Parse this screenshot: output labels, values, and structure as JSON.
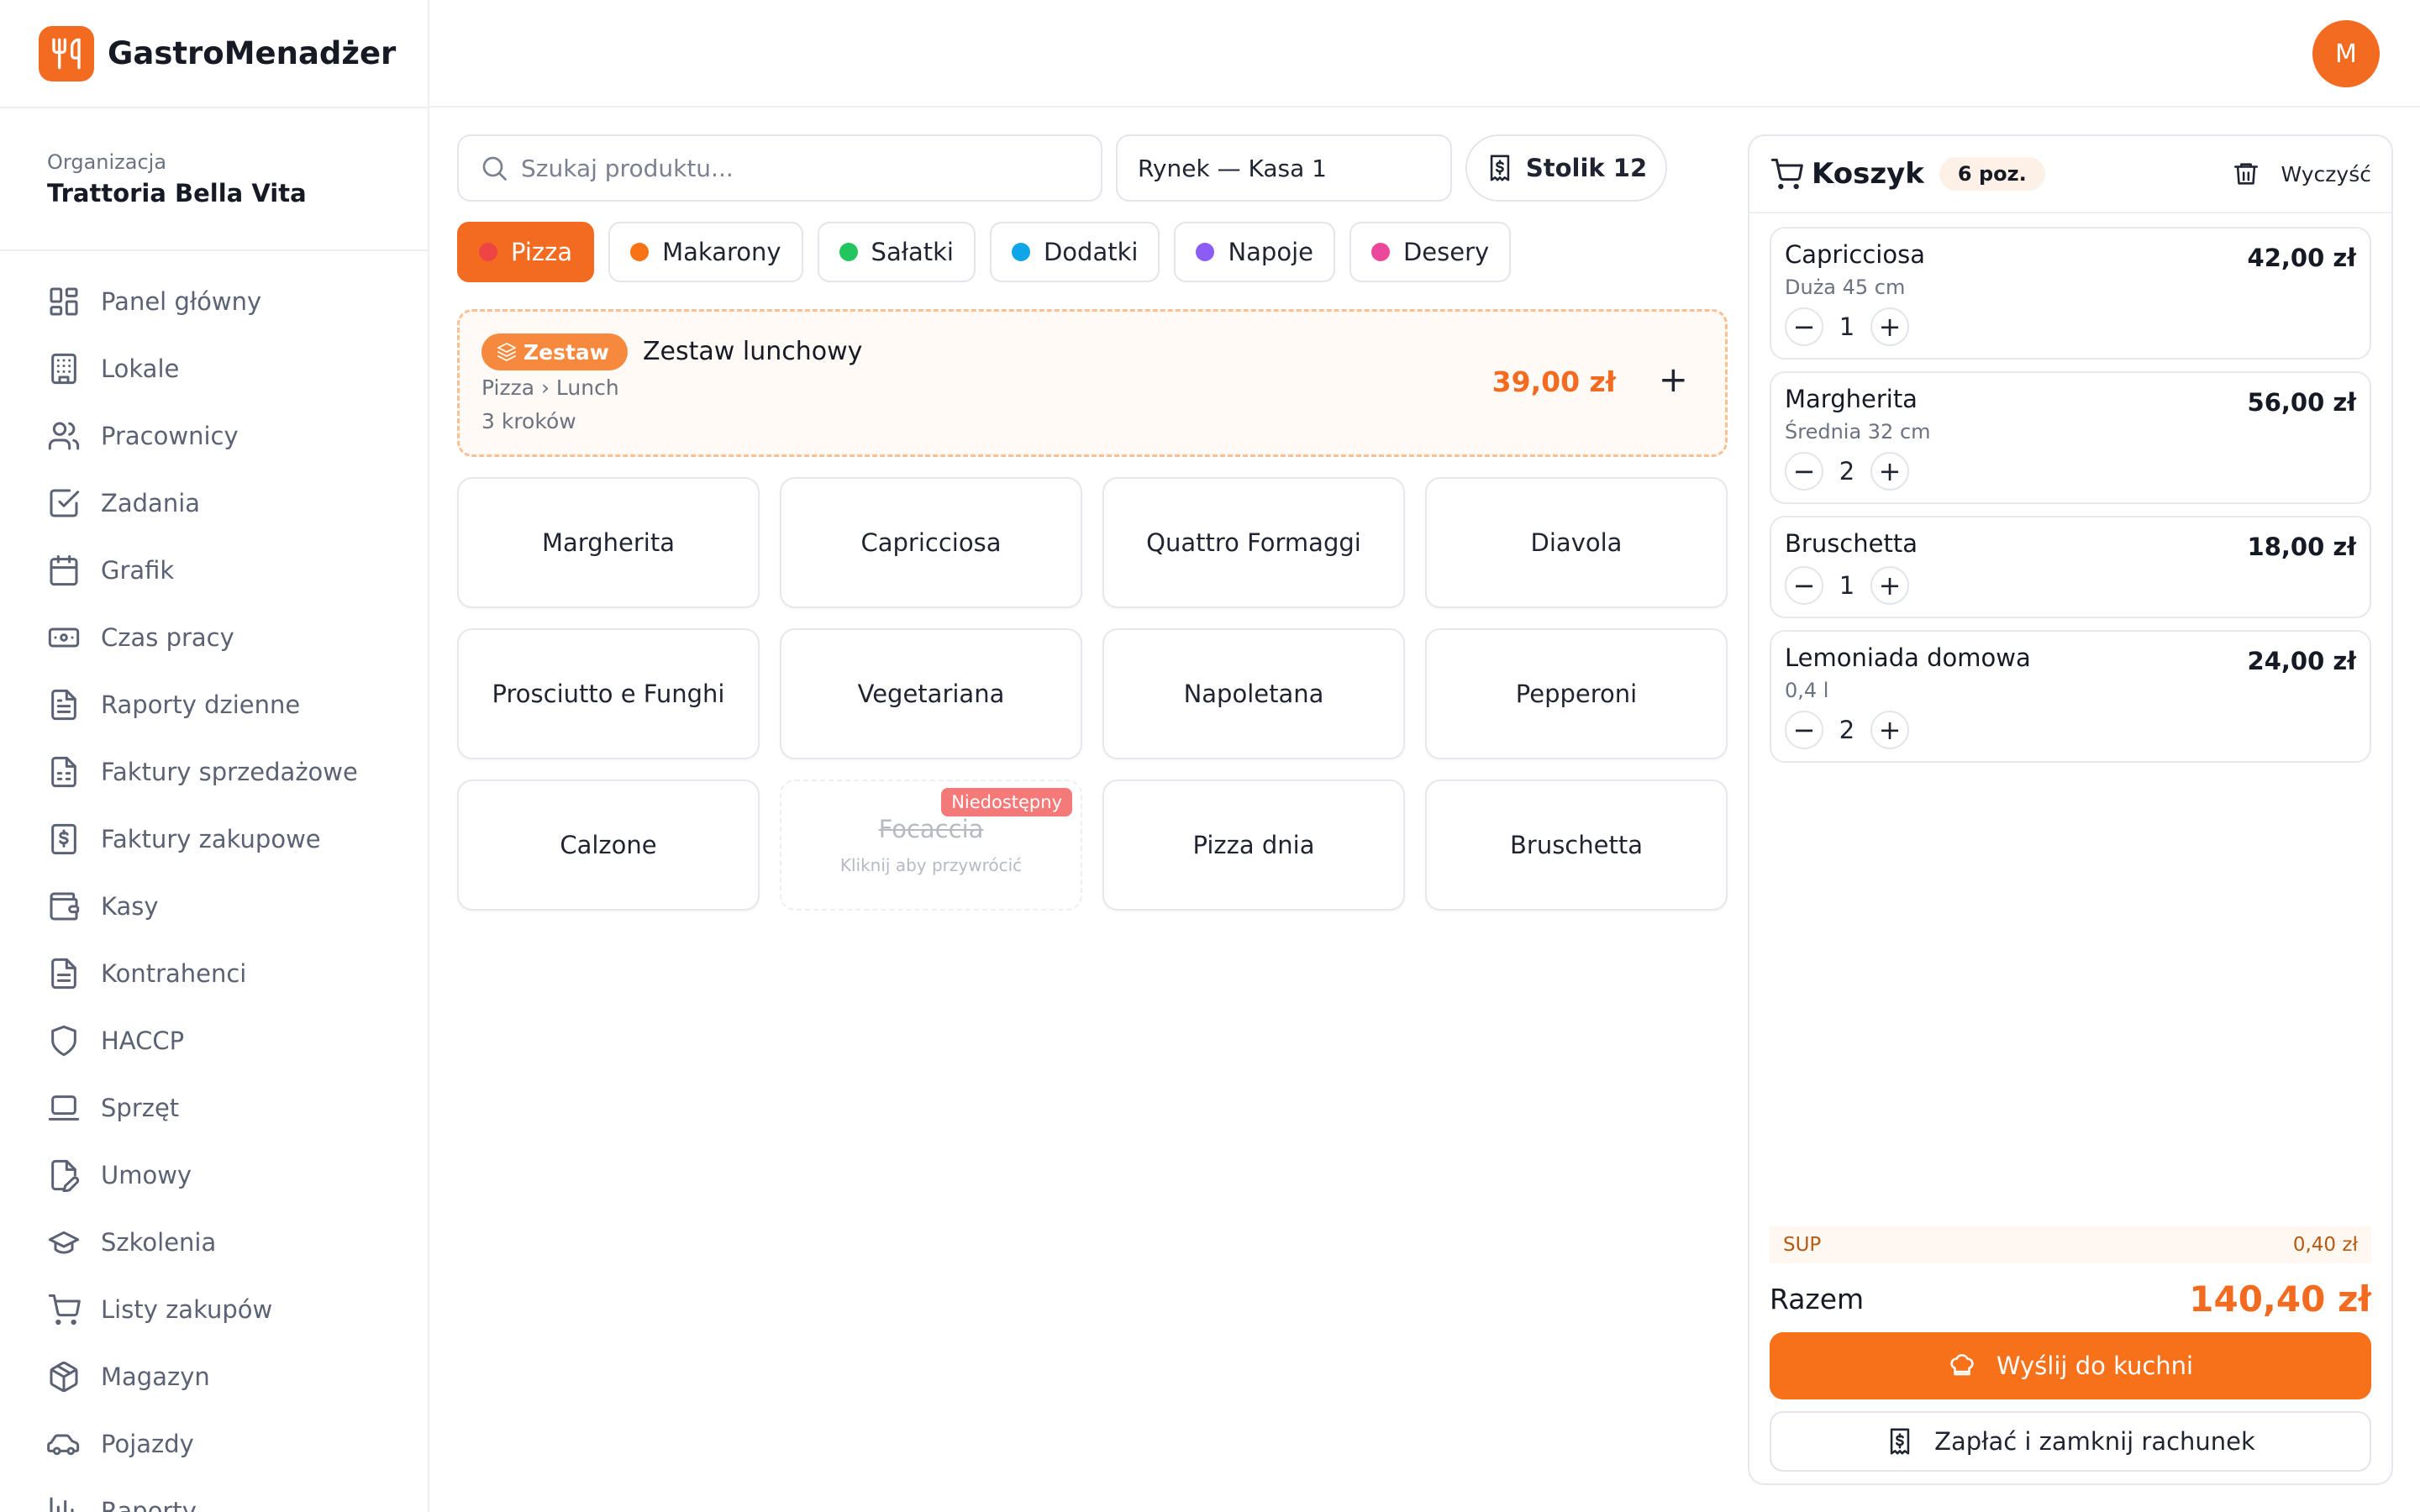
{
  "app": {
    "name": "GastroMenadżer",
    "logo_icon": "utensils-icon",
    "accent": "#f26b21"
  },
  "user": {
    "avatar_initial": "M"
  },
  "organization": {
    "label": "Organizacja",
    "name": "Trattoria Bella Vita"
  },
  "sidebar": {
    "items": [
      {
        "label": "Panel główny",
        "icon": "dashboard-icon"
      },
      {
        "label": "Lokale",
        "icon": "building-icon"
      },
      {
        "label": "Pracownicy",
        "icon": "users-icon"
      },
      {
        "label": "Zadania",
        "icon": "checkbox-icon"
      },
      {
        "label": "Grafik",
        "icon": "calendar-icon"
      },
      {
        "label": "Czas pracy",
        "icon": "banknote-icon"
      },
      {
        "label": "Raporty dzienne",
        "icon": "file-text-icon"
      },
      {
        "label": "Faktury sprzedażowe",
        "icon": "receipt-icon"
      },
      {
        "label": "Faktury zakupowe",
        "icon": "invoice-dollar-icon"
      },
      {
        "label": "Kasy",
        "icon": "wallet-icon"
      },
      {
        "label": "Kontrahenci",
        "icon": "file-icon"
      },
      {
        "label": "HACCP",
        "icon": "shield-icon"
      },
      {
        "label": "Sprzęt",
        "icon": "laptop-icon"
      },
      {
        "label": "Umowy",
        "icon": "file-pen-icon"
      },
      {
        "label": "Szkolenia",
        "icon": "graduation-cap-icon"
      },
      {
        "label": "Listy zakupów",
        "icon": "shopping-cart-icon"
      },
      {
        "label": "Magazyn",
        "icon": "package-icon"
      },
      {
        "label": "Pojazdy",
        "icon": "car-icon"
      },
      {
        "label": "Raporty",
        "icon": "chart-icon"
      }
    ]
  },
  "pos": {
    "search_placeholder": "Szukaj produktu...",
    "register": "Rynek — Kasa 1",
    "table": "Stolik 12",
    "categories": [
      {
        "label": "Pizza",
        "color": "#ef4444",
        "active": true
      },
      {
        "label": "Makarony",
        "color": "#f97316",
        "active": false
      },
      {
        "label": "Sałatki",
        "color": "#22c55e",
        "active": false
      },
      {
        "label": "Dodatki",
        "color": "#0ea5e9",
        "active": false
      },
      {
        "label": "Napoje",
        "color": "#8b5cf6",
        "active": false
      },
      {
        "label": "Desery",
        "color": "#ec4899",
        "active": false
      }
    ],
    "combo": {
      "badge": "Zestaw",
      "name": "Zestaw lunchowy",
      "path": "Pizza › Lunch",
      "steps": "3 kroków",
      "price": "39,00 zł",
      "add": "+"
    },
    "products": [
      {
        "name": "Margherita"
      },
      {
        "name": "Capricciosa"
      },
      {
        "name": "Quattro Formaggi"
      },
      {
        "name": "Diavola"
      },
      {
        "name": "Prosciutto e Funghi"
      },
      {
        "name": "Vegetariana"
      },
      {
        "name": "Napoletana"
      },
      {
        "name": "Pepperoni"
      },
      {
        "name": "Calzone"
      },
      {
        "name": "Focaccia",
        "unavailable": true,
        "badge": "Niedostępny",
        "hint": "Kliknij aby przywrócić"
      },
      {
        "name": "Pizza dnia"
      },
      {
        "name": "Bruschetta"
      }
    ]
  },
  "cart": {
    "title": "Koszyk",
    "count": "6 poz.",
    "clear": "Wyczyść",
    "items": [
      {
        "name": "Capricciosa",
        "variant": "Duża 45 cm",
        "price": "42,00 zł",
        "qty": "1"
      },
      {
        "name": "Margherita",
        "variant": "Średnia 32 cm",
        "price": "56,00 zł",
        "qty": "2"
      },
      {
        "name": "Bruschetta",
        "variant": "",
        "price": "18,00 zł",
        "qty": "1"
      },
      {
        "name": "Lemoniada domowa",
        "variant": "0,4 l",
        "price": "24,00 zł",
        "qty": "2"
      }
    ],
    "tax_label": "SUP",
    "tax_value": "0,40 zł",
    "total_label": "Razem",
    "total_value": "140,40 zł",
    "send_label": "Wyślij do kuchni",
    "pay_label": "Zapłać i zamknij rachunek"
  }
}
